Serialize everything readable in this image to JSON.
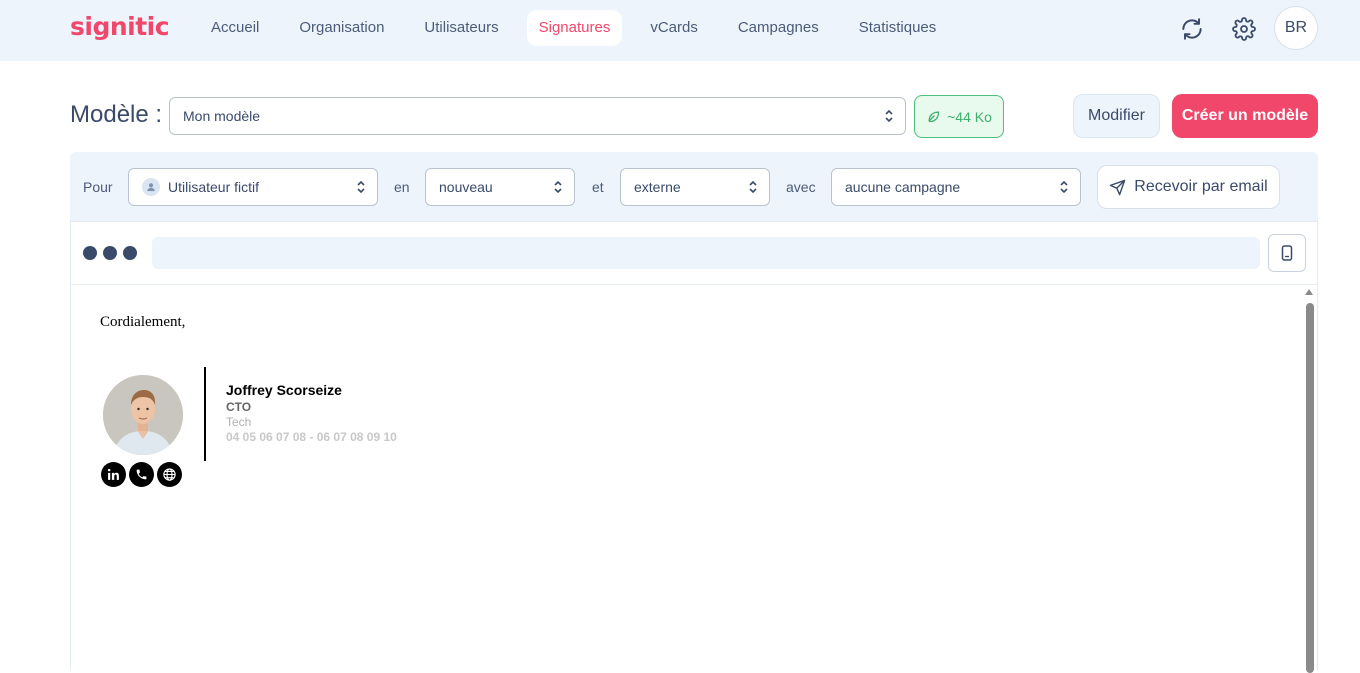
{
  "app": {
    "logo": "signitic"
  },
  "nav": {
    "items": [
      {
        "label": "Accueil"
      },
      {
        "label": "Organisation"
      },
      {
        "label": "Utilisateurs"
      },
      {
        "label": "Signatures",
        "active": true
      },
      {
        "label": "vCards"
      },
      {
        "label": "Campagnes"
      },
      {
        "label": "Statistiques"
      }
    ],
    "avatar_initials": "BR",
    "icons": [
      "sync-icon",
      "gear-icon"
    ]
  },
  "model": {
    "label": "Modèle :",
    "selected": "Mon modèle",
    "weight": "~44 Ko",
    "modify_label": "Modifier",
    "create_label": "Créer un modèle"
  },
  "filters": {
    "pour_label": "Pour",
    "user_value": "Utilisateur fictif",
    "en_label": "en",
    "mode_value": "nouveau",
    "et_label": "et",
    "scope_value": "externe",
    "avec_label": "avec",
    "campaign_value": "aucune campagne",
    "email_button": "Recevoir par email"
  },
  "preview": {
    "greeting": "Cordialement,",
    "name": "Joffrey Scorseize",
    "role": "CTO",
    "department": "Tech",
    "phones": "04 05 06 07 08 - 06 07 08 09 10",
    "socials": [
      "linkedin-icon",
      "phone-icon",
      "globe-icon"
    ]
  },
  "colors": {
    "brand": "#f0476b",
    "nav_bg": "#eef4fc",
    "text": "#3a4a6b",
    "weight_green": "#3ab06a"
  }
}
